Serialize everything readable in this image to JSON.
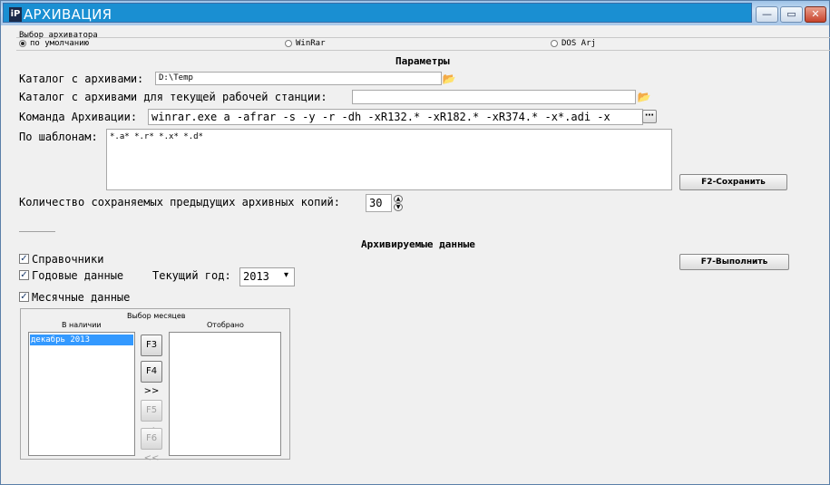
{
  "window": {
    "title": "АРХИВАЦИЯ",
    "icon_text": "iP",
    "minimize_glyph": "—",
    "restore_glyph": "▭",
    "close_glyph": "✕"
  },
  "archiver": {
    "group_title": "Выбор архиватора",
    "options": [
      {
        "label": "по умолчанию",
        "selected": true
      },
      {
        "label": "WinRar",
        "selected": false
      },
      {
        "label": "DOS Arj",
        "selected": false
      }
    ]
  },
  "params": {
    "title": "Параметры",
    "archive_dir_label": "Каталог с архивами:",
    "archive_dir_value": "D:\\Temp",
    "ws_dir_label": "Каталог с архивами для текущей рабочей станции:",
    "ws_dir_value": "",
    "command_label": "Команда Архивации:",
    "command_value": "winrar.exe a -afrar -s -y -r -dh -xR132.* -xR182.* -xR374.* -x*.adi -x",
    "ellipsis_glyph": "⋯",
    "patterns_label": "По шаблонам:",
    "patterns_value": "*.a* *.r* *.x* *.d*",
    "copies_label": "Количество сохраняемых предыдущих архивных копий:",
    "copies_value": "30",
    "spin_up": "▲",
    "spin_down": "▼",
    "folder_glyph": "📂"
  },
  "buttons": {
    "save": "F2-Сохранить",
    "run": "F7-Выполнить"
  },
  "archived": {
    "title": "Архивируемые данные",
    "checks": [
      {
        "label": "Справочники",
        "checked": true
      },
      {
        "label": "Годовые данные",
        "checked": true
      },
      {
        "label": "Месячные данные",
        "checked": true
      }
    ],
    "check_glyph": "✓",
    "year_label": "Текущий год:",
    "year_value": "2013",
    "year_dropdown": "▾"
  },
  "months": {
    "group_title": "Выбор месяцев",
    "available_label": "В наличии",
    "selected_label": "Отобрано",
    "available_items": [
      "декабрь  2013"
    ],
    "selected_items": [],
    "move_buttons": [
      {
        "label": "F3 >",
        "enabled": true
      },
      {
        "label": "F4 >>",
        "enabled": true
      },
      {
        "label": "F5 <",
        "enabled": false
      },
      {
        "label": "F6 <<",
        "enabled": false
      }
    ]
  }
}
